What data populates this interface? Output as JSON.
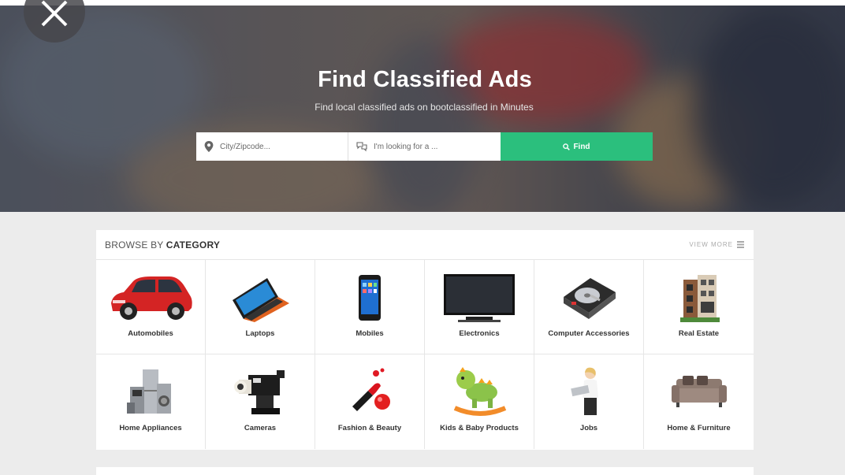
{
  "hero": {
    "title": "Find Classified Ads",
    "subtitle": "Find local classified ads on bootclassified in Minutes",
    "city_placeholder": "City/Zipcode...",
    "looking_placeholder": "I'm looking for a ...",
    "find_label": "Find"
  },
  "categories_section": {
    "title_prefix": "BROWSE BY ",
    "title_bold": "CATEGORY",
    "view_more": "VIEW MORE",
    "items": [
      {
        "label": "Automobiles",
        "icon": "car-icon"
      },
      {
        "label": "Laptops",
        "icon": "laptop-icon"
      },
      {
        "label": "Mobiles",
        "icon": "mobile-phone-icon"
      },
      {
        "label": "Electronics",
        "icon": "television-icon"
      },
      {
        "label": "Computer Accessories",
        "icon": "hard-drive-icon"
      },
      {
        "label": "Real Estate",
        "icon": "building-icon"
      },
      {
        "label": "Home Appliances",
        "icon": "appliances-icon"
      },
      {
        "label": "Cameras",
        "icon": "video-camera-icon"
      },
      {
        "label": "Fashion & Beauty",
        "icon": "nail-polish-icon"
      },
      {
        "label": "Kids & Baby Products",
        "icon": "rocking-toy-icon"
      },
      {
        "label": "Jobs",
        "icon": "businesswoman-icon"
      },
      {
        "label": "Home & Furniture",
        "icon": "sofa-icon"
      }
    ]
  },
  "colors": {
    "accent_green": "#2bbf7d",
    "page_bg": "#ececec"
  }
}
